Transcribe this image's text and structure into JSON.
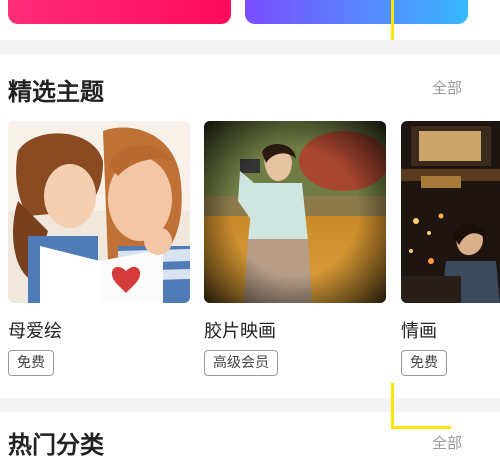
{
  "featured": {
    "title": "精选主题",
    "more_label": "全部",
    "cards": [
      {
        "title": "母爱绘",
        "badge": "免费"
      },
      {
        "title": "胶片映画",
        "badge": "高级会员"
      },
      {
        "title": "情画",
        "badge": "免费"
      }
    ]
  },
  "hot": {
    "title": "热门分类",
    "more_label": "全部"
  },
  "colors": {
    "banner_left": "#ff1f6e",
    "banner_right_start": "#7b4dff",
    "banner_right_end": "#38b8ff",
    "marker_line": "#ffe600"
  }
}
